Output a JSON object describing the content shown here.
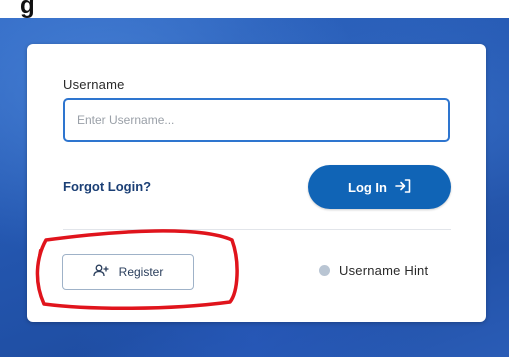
{
  "page": {
    "heading_fragment": "g"
  },
  "login_card": {
    "username_label": "Username",
    "username_placeholder": "Enter Username...",
    "username_value": "",
    "forgot_login_label": "Forgot Login?",
    "login_button_label": "Log In",
    "register_button_label": "Register",
    "username_hint_label": "Username Hint"
  },
  "icons": {
    "login_button": "sign-in-arrow-icon",
    "register_button": "add-user-icon",
    "username_hint": "info-dot-icon"
  },
  "colors": {
    "accent_blue": "#1064b6",
    "input_border": "#2e75cf",
    "annotation_red": "#e0141c"
  }
}
